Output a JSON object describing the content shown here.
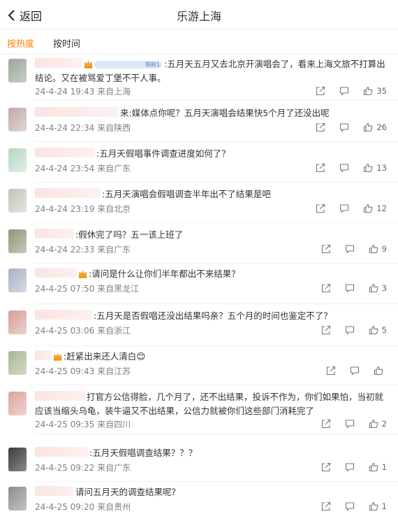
{
  "header": {
    "back_label": "返回",
    "title": "乐游上海"
  },
  "tabs": [
    {
      "label": "按热度",
      "active": true
    },
    {
      "label": "按时间",
      "active": false
    }
  ],
  "colors": {
    "accent": "#ff8200",
    "meta": "#808080",
    "text": "#333333"
  },
  "comments": [
    {
      "text": ":五月天五月又去北京开演唱会了，看来上海文旅不打算出结论。又在被骂爱丁堡不干人事。",
      "badge": true,
      "vtag": "铁粉1",
      "time": "24-4-24 19:43",
      "location": "来自上海",
      "likes": "35"
    },
    {
      "text": "来:媒体点你呢？五月天演唱会结果快5个月了还没出呢",
      "badge": false,
      "vtag": "",
      "time": "24-4-24 22:34",
      "location": "来自陕西",
      "likes": "26"
    },
    {
      "text": ":五月天假唱事件调查进度如何了？",
      "badge": false,
      "vtag": "",
      "time": "24-4-24 23:54",
      "location": "来自广东",
      "likes": "13"
    },
    {
      "text": ":五月天演唱会假唱调查半年出不了结果是吧",
      "badge": false,
      "vtag": "",
      "time": "24-4-24 23:19",
      "location": "来自北京",
      "likes": "12"
    },
    {
      "text": ":假休完了吗？五一该上班了",
      "badge": false,
      "vtag": "",
      "time": "24-4-24 22:33",
      "location": "来自广东",
      "likes": "9"
    },
    {
      "text": ":请问是什么让你们半年都出不来结果？",
      "badge": true,
      "vtag": "",
      "time": "24-4-25 07:50",
      "location": "来自黑龙江",
      "likes": "3"
    },
    {
      "text": ":五月天是否假唱还没出结果吗亲？五个月的时间也鉴定不了？",
      "badge": false,
      "vtag": "",
      "time": "24-4-25 03:06",
      "location": "来自浙江",
      "likes": "5"
    },
    {
      "text": ":赶紧出来还人清白😊",
      "badge": true,
      "vtag": "",
      "time": "24-4-25 09:43",
      "location": "来自江苏",
      "likes": ""
    },
    {
      "text": "打官方公信得脸，几个月了，还不出结果，投诉不作为，你们如果怕，当初就应该当缩头乌龟，装牛逼又不出结果，公信力就被你们这些部门消耗完了",
      "badge": false,
      "vtag": "",
      "time": "24-4-25 09:35",
      "location": "来自四川",
      "likes": "2"
    },
    {
      "text": ":五月天假唱调查结果？？？",
      "badge": false,
      "vtag": "",
      "time": "24-4-25 09:22",
      "location": "来自广东",
      "likes": "1"
    },
    {
      "text": "请问五月天的调查结果呢？",
      "badge": false,
      "vtag": "",
      "time": "24-4-25 09:20",
      "location": "来自贵州",
      "likes": "1"
    }
  ]
}
